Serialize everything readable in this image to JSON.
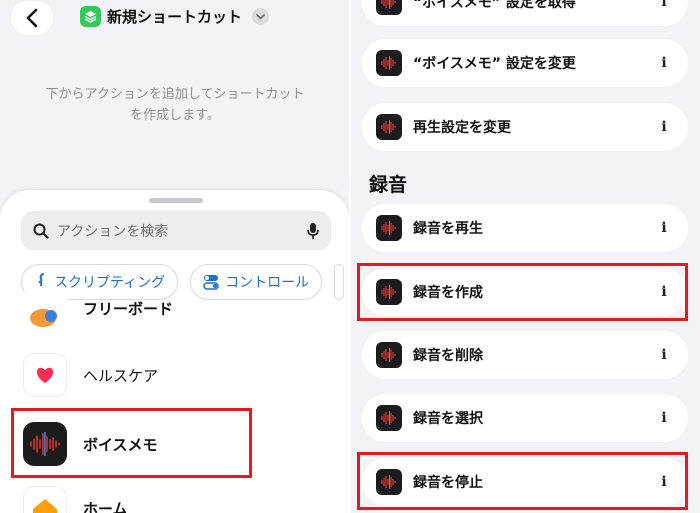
{
  "left": {
    "title": "新規ショートカット",
    "empty_message": "下からアクションを追加してショートカットを作成します。",
    "search": {
      "placeholder": "アクションを検索"
    },
    "chips": [
      {
        "label": "スクリプティング",
        "icon": "scripting-icon"
      },
      {
        "label": "コントロール",
        "icon": "toggle-icon"
      }
    ],
    "apps": [
      {
        "label": "フリーボード",
        "icon": "freeform-icon"
      },
      {
        "label": "ヘルスケア",
        "icon": "heart-icon"
      },
      {
        "label": "ボイスメモ",
        "icon": "voice-memos-icon"
      },
      {
        "label": "ホーム",
        "icon": "home-icon"
      }
    ]
  },
  "right": {
    "actions_top": [
      {
        "label": "“ボイスメモ” 設定を取得"
      },
      {
        "label": "“ボイスメモ” 設定を変更"
      },
      {
        "label": "再生設定を変更"
      }
    ],
    "section_title": "録音",
    "actions": [
      {
        "label": "録音を再生"
      },
      {
        "label": "録音を作成"
      },
      {
        "label": "録音を削除"
      },
      {
        "label": "録音を選択"
      },
      {
        "label": "録音を停止"
      }
    ],
    "info_glyph": "i"
  },
  "colors": {
    "accent": "#1a6fd6",
    "highlight": "#e51b1b",
    "shortcut_green": "#34c759"
  }
}
